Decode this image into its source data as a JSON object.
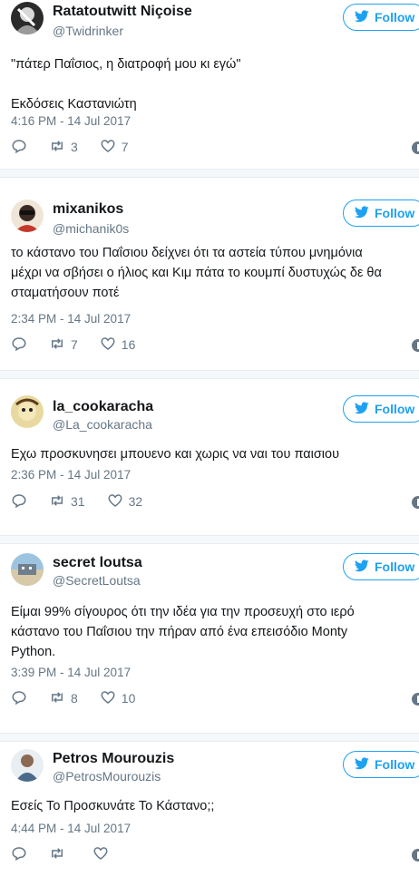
{
  "colors": {
    "accent": "#1da1f2",
    "secondary_text": "#657786",
    "primary_text": "#14171a",
    "divider": "#e1e8ed"
  },
  "follow_label": "Follow",
  "tweets": [
    {
      "name": "Ratatoutwitt Niçoise",
      "handle": "@Twidrinker",
      "text": "\"πάτερ Παΐσιος, η διατροφή μου κι εγώ\"\n\nΕκδόσεις Καστανιώτη",
      "time": "4:16 PM - 14 Jul 2017",
      "retweets": "3",
      "likes": "7"
    },
    {
      "name": "mixanikos",
      "handle": "@michanik0s",
      "text": "το κάστανο του Παΐσιου δείχνει ότι τα αστεία τύπου μνημόνια\nμέχρι να σβήσει ο ήλιος και Κιμ πάτα το κουμπί δυστυχώς δε θα\nσταματήσουν ποτέ",
      "time": "2:34 PM - 14 Jul 2017",
      "retweets": "7",
      "likes": "16"
    },
    {
      "name": "la_cookaracha",
      "handle": "@La_cookaracha",
      "text": "Εχω προσκυνησει μπουενο και χωρις να ναι του παισιου",
      "time": "2:36 PM - 14 Jul 2017",
      "retweets": "31",
      "likes": "32"
    },
    {
      "name": "secret loutsa",
      "handle": "@SecretLoutsa",
      "text": "Είμαι 99% σίγουρος ότι την ιδέα για την προσευχή στο ιερό\nκάστανο του Παΐσιου την πήραν από ένα επεισόδιο Monty\nPython.",
      "time": "3:39 PM - 14 Jul 2017",
      "retweets": "8",
      "likes": "10"
    },
    {
      "name": "Petros Mourouzis",
      "handle": "@PetrosMourouzis",
      "text": "Εσείς Το Προσκυνάτε Το Κάστανο;;",
      "time": "4:44 PM - 14 Jul 2017",
      "retweets": "",
      "likes": ""
    }
  ]
}
